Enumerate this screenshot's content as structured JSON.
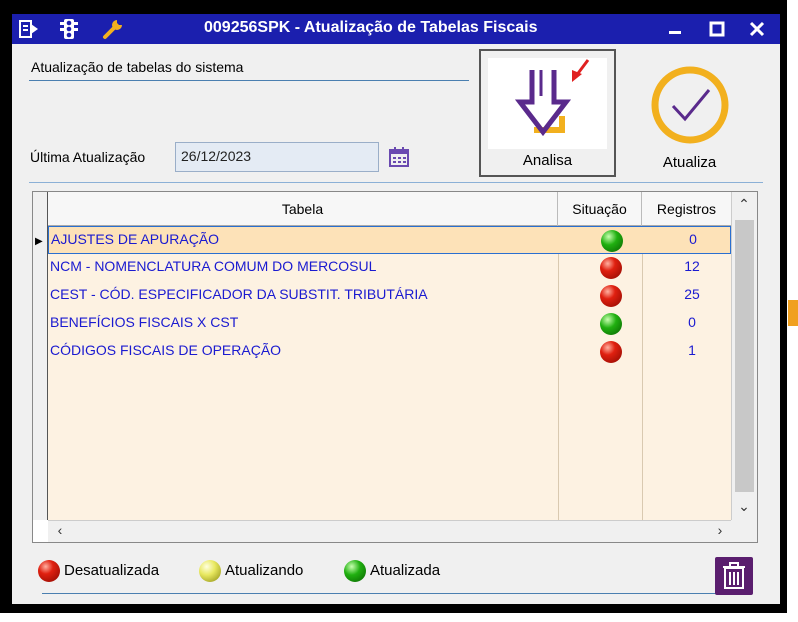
{
  "window": {
    "title": "009256SPK - Atualização de Tabelas Fiscais",
    "toolbar_icons": [
      "menu-arrow-icon",
      "traffic-light-icon",
      "wrench-icon"
    ],
    "controls": [
      "minimize",
      "maximize",
      "close"
    ]
  },
  "header": {
    "caption": "Atualização de tabelas do sistema",
    "last_update_label": "Última Atualização",
    "last_update_value": "26/12/2023"
  },
  "actions": {
    "analisa_label": "Analisa",
    "atualiza_label": "Atualiza"
  },
  "grid": {
    "columns": [
      "Tabela",
      "Situação",
      "Registros"
    ],
    "rows": [
      {
        "tabela": "AJUSTES DE APURAÇÃO",
        "situacao": "green",
        "registros": "0",
        "selected": true
      },
      {
        "tabela": "NCM - NOMENCLATURA COMUM DO MERCOSUL",
        "situacao": "red",
        "registros": "12"
      },
      {
        "tabela": "CEST - CÓD. ESPECIFICADOR DA SUBSTIT. TRIBUTÁRIA",
        "situacao": "red",
        "registros": "25"
      },
      {
        "tabela": "BENEFÍCIOS FISCAIS X CST",
        "situacao": "green",
        "registros": "0"
      },
      {
        "tabela": "CÓDIGOS FISCAIS DE OPERAÇÃO",
        "situacao": "red",
        "registros": "1"
      }
    ]
  },
  "legend": [
    {
      "color": "red",
      "label": "Desatualizada"
    },
    {
      "color": "yellow",
      "label": "Atualizando"
    },
    {
      "color": "green",
      "label": "Atualizada"
    }
  ],
  "colors": {
    "titlebar": "#1b1fae",
    "grid_text": "#1a1ad0",
    "row_background": "#fdf2e2",
    "selected_row": "#fde2b8",
    "accent_purple": "#5a2a8c",
    "accent_gold": "#f2b01e"
  }
}
